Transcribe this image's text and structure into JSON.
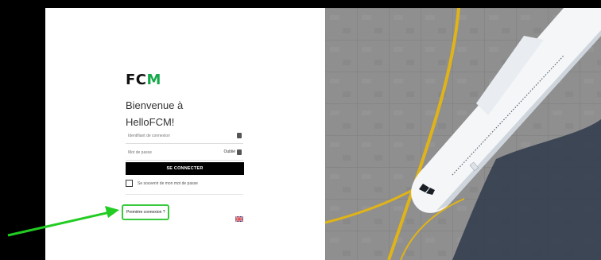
{
  "brand": {
    "logo_prefix": "FC",
    "logo_accent": "M",
    "accent_color": "#17a84a"
  },
  "welcome": {
    "line1": "Bienvenue à",
    "line2": "HelloFCM!"
  },
  "form": {
    "login_placeholder": "Identifiant de connexion",
    "password_placeholder": "Mot de passe",
    "forgot_label": "Oublié",
    "submit_label": "SE CONNECTER",
    "remember_label": "Se souvenir de mon mot de passe"
  },
  "footer": {
    "first_login_label": "Première connexion ?",
    "language_icon": "uk-flag-icon"
  },
  "annotation": {
    "highlight_color": "#39c93c"
  }
}
